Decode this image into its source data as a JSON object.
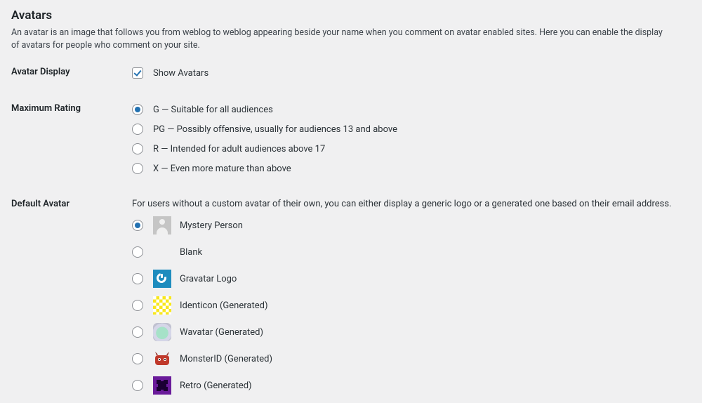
{
  "section": {
    "title": "Avatars",
    "description": "An avatar is an image that follows you from weblog to weblog appearing beside your name when you comment on avatar enabled sites. Here you can enable the display of avatars for people who comment on your site."
  },
  "avatar_display": {
    "label": "Avatar Display",
    "checkbox_label": "Show Avatars",
    "checked": true
  },
  "max_rating": {
    "label": "Maximum Rating",
    "selected": "G",
    "options": [
      {
        "value": "G",
        "text": "G — Suitable for all audiences"
      },
      {
        "value": "PG",
        "text": "PG — Possibly offensive, usually for audiences 13 and above"
      },
      {
        "value": "R",
        "text": "R — Intended for adult audiences above 17"
      },
      {
        "value": "X",
        "text": "X — Even more mature than above"
      }
    ]
  },
  "default_avatar": {
    "label": "Default Avatar",
    "description": "For users without a custom avatar of their own, you can either display a generic logo or a generated one based on their email address.",
    "selected": "mystery",
    "options": [
      {
        "value": "mystery",
        "text": "Mystery Person",
        "icon": "mystery"
      },
      {
        "value": "blank",
        "text": "Blank",
        "icon": "blank"
      },
      {
        "value": "gravatar",
        "text": "Gravatar Logo",
        "icon": "gravatar"
      },
      {
        "value": "identicon",
        "text": "Identicon (Generated)",
        "icon": "identicon"
      },
      {
        "value": "wavatar",
        "text": "Wavatar (Generated)",
        "icon": "wavatar"
      },
      {
        "value": "monsterid",
        "text": "MonsterID (Generated)",
        "icon": "monster"
      },
      {
        "value": "retro",
        "text": "Retro (Generated)",
        "icon": "retro"
      }
    ]
  }
}
